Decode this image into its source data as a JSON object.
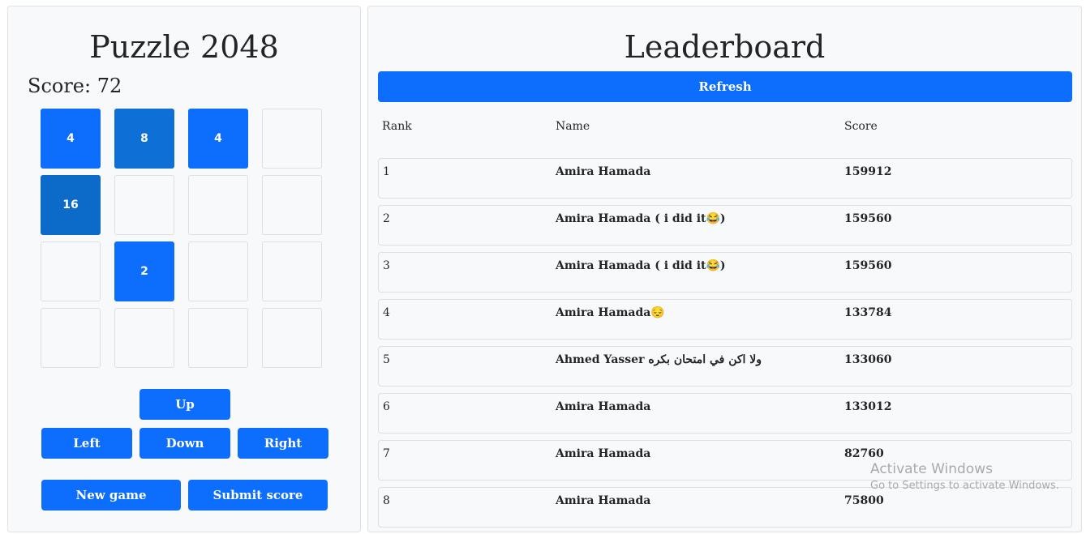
{
  "game": {
    "title": "Puzzle 2048",
    "score_label": "Score: 72",
    "grid": [
      [
        "4",
        "8",
        "4",
        ""
      ],
      [
        "16",
        "",
        "",
        ""
      ],
      [
        "",
        "2",
        "",
        ""
      ],
      [
        "",
        "",
        "",
        ""
      ]
    ],
    "controls": {
      "up": "Up",
      "left": "Left",
      "down": "Down",
      "right": "Right",
      "new_game": "New game",
      "submit_score": "Submit score"
    }
  },
  "leaderboard": {
    "title": "Leaderboard",
    "refresh_label": "Refresh",
    "columns": [
      "Rank",
      "Name",
      "Score"
    ],
    "rows": [
      {
        "rank": "1",
        "name": "Amira Hamada",
        "score": "159912"
      },
      {
        "rank": "2",
        "name": "Amira Hamada ( i did it😂)",
        "score": "159560"
      },
      {
        "rank": "3",
        "name": "Amira Hamada ( i did it😂)",
        "score": "159560"
      },
      {
        "rank": "4",
        "name": "Amira Hamada😔",
        "score": "133784"
      },
      {
        "rank": "5",
        "name": "Ahmed Yasser ولا اكن في امتحان بكره",
        "score": "133060"
      },
      {
        "rank": "6",
        "name": "Amira Hamada",
        "score": "133012"
      },
      {
        "rank": "7",
        "name": "Amira Hamada",
        "score": "82760"
      },
      {
        "rank": "8",
        "name": "Amira Hamada",
        "score": "75800"
      }
    ]
  },
  "watermark": {
    "title": "Activate Windows",
    "subtitle": "Go to Settings to activate Windows."
  },
  "colors": {
    "primary": "#0d6efd",
    "panel_bg": "#f8f9fa",
    "border": "#dee2e6"
  }
}
